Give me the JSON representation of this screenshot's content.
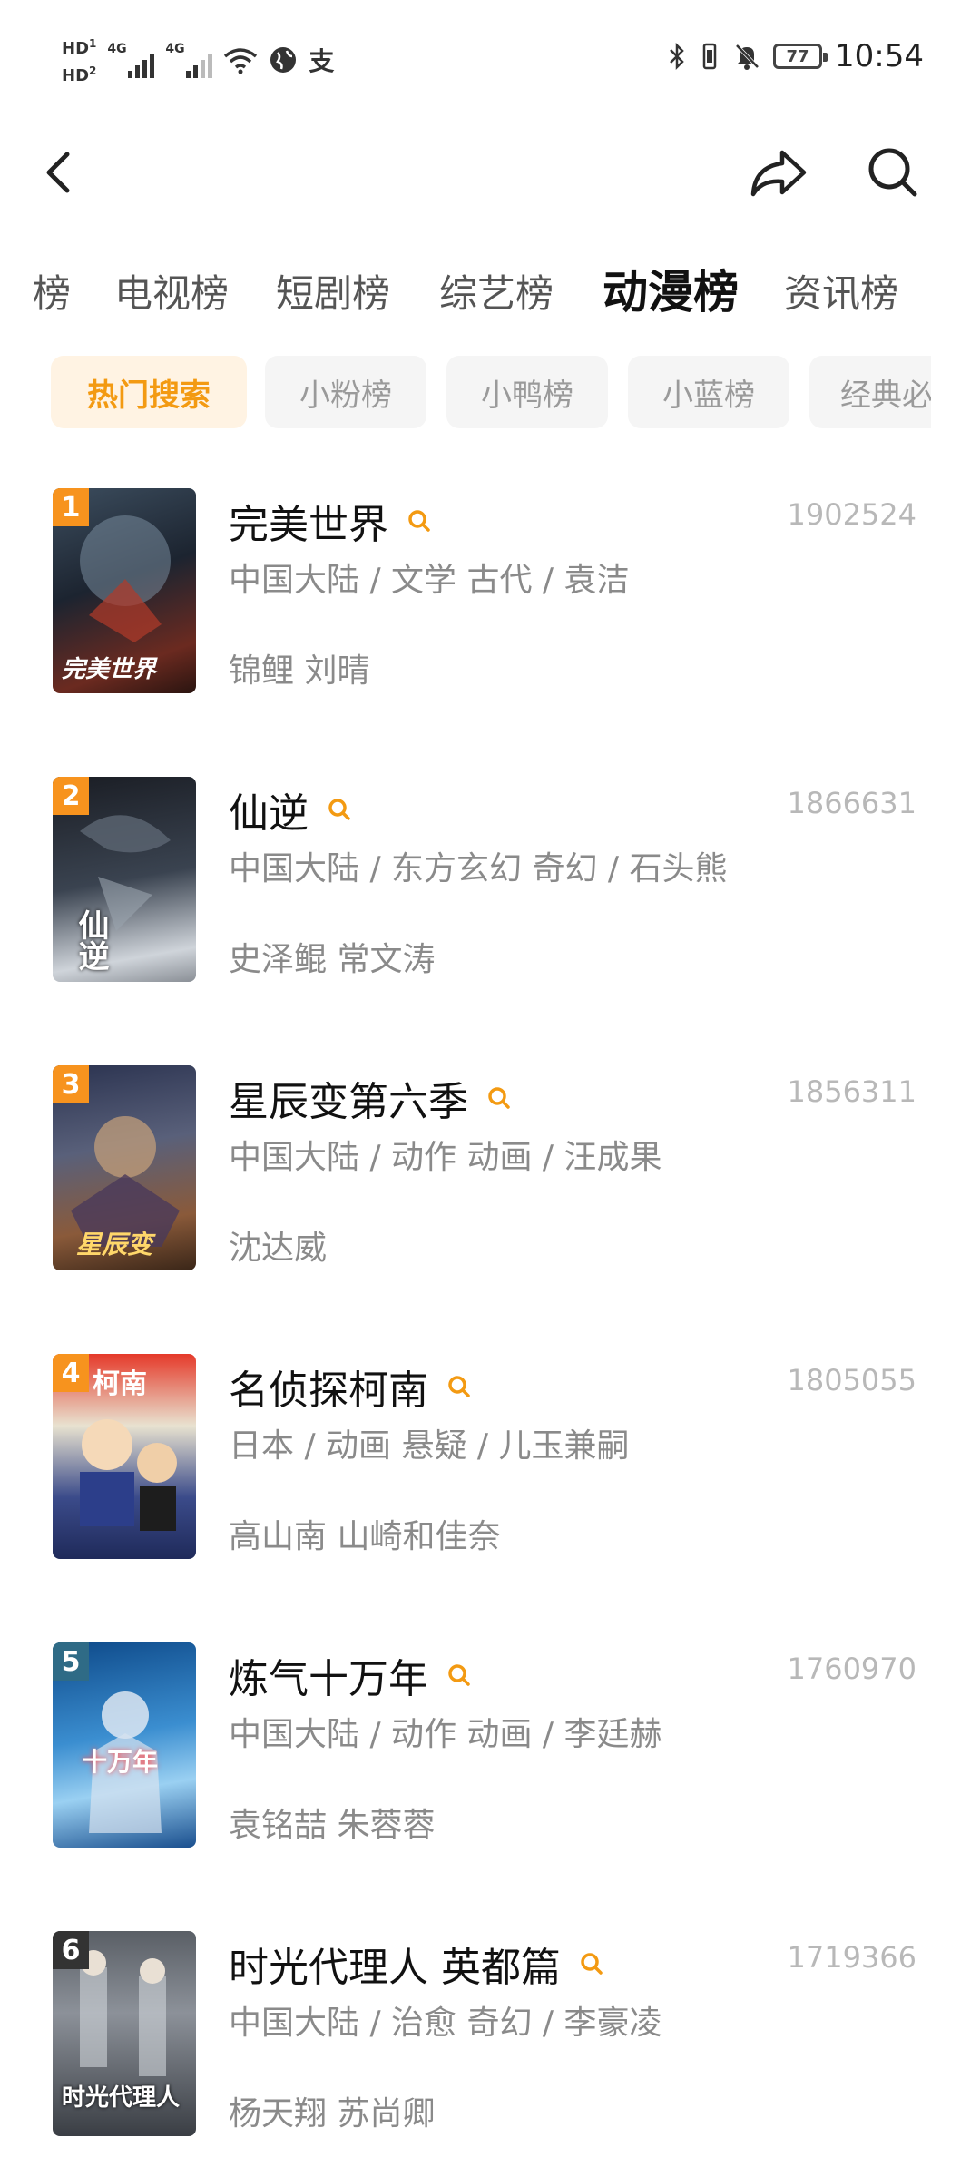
{
  "status_bar": {
    "hd1": "HD",
    "hd1_sub": "1",
    "hd2": "HD",
    "hd2_sub": "2",
    "sig1": "4G",
    "sig2": "4G",
    "alipay": "支",
    "battery": "77",
    "time": "10:54"
  },
  "header": {
    "back_icon": "chevron-left-icon",
    "share_icon": "share-icon",
    "search_icon": "search-icon"
  },
  "category_tabs": [
    {
      "label": "榜"
    },
    {
      "label": "电视榜"
    },
    {
      "label": "短剧榜"
    },
    {
      "label": "综艺榜"
    },
    {
      "label": "动漫榜"
    },
    {
      "label": "资讯榜"
    }
  ],
  "active_category": "动漫榜",
  "sub_tabs": [
    {
      "label": "热门搜索"
    },
    {
      "label": "小粉榜"
    },
    {
      "label": "小鸭榜"
    },
    {
      "label": "小蓝榜"
    },
    {
      "label": "经典必"
    }
  ],
  "colors": {
    "accent": "#f39a12",
    "rank_orange": "#f7931e",
    "rank_teal": "#2f6b86",
    "rank_dark": "#333333"
  },
  "items": [
    {
      "rank": "1",
      "title": "完美世界",
      "meta": "中国大陆 / 文学 古代 / 袁洁",
      "cast": "锦鲤 刘晴",
      "count": "1902524",
      "cover_text": "完美世界"
    },
    {
      "rank": "2",
      "title": "仙逆",
      "meta": "中国大陆 / 东方玄幻 奇幻 / 石头熊",
      "cast": "史泽鲲 常文涛",
      "count": "1866631",
      "cover_text": "仙逆"
    },
    {
      "rank": "3",
      "title": "星辰变第六季",
      "meta": "中国大陆 / 动作 动画 / 汪成果",
      "cast": "沈达威",
      "count": "1856311",
      "cover_text": "星辰变"
    },
    {
      "rank": "4",
      "title": "名侦探柯南",
      "meta": "日本 / 动画 悬疑 / 儿玉兼嗣",
      "cast": "高山南 山崎和佳奈",
      "count": "1805055",
      "cover_text": "柯南"
    },
    {
      "rank": "5",
      "title": "炼气十万年",
      "meta": "中国大陆 / 动作 动画 / 李廷赫",
      "cast": "袁铭喆 朱蓉蓉",
      "count": "1760970",
      "cover_text": "十万年"
    },
    {
      "rank": "6",
      "title": "时光代理人 英都篇",
      "meta": "中国大陆 / 治愈 奇幻 / 李豪凌",
      "cast": "杨天翔 苏尚卿",
      "count": "1719366",
      "cover_text": "时光代理人"
    }
  ]
}
